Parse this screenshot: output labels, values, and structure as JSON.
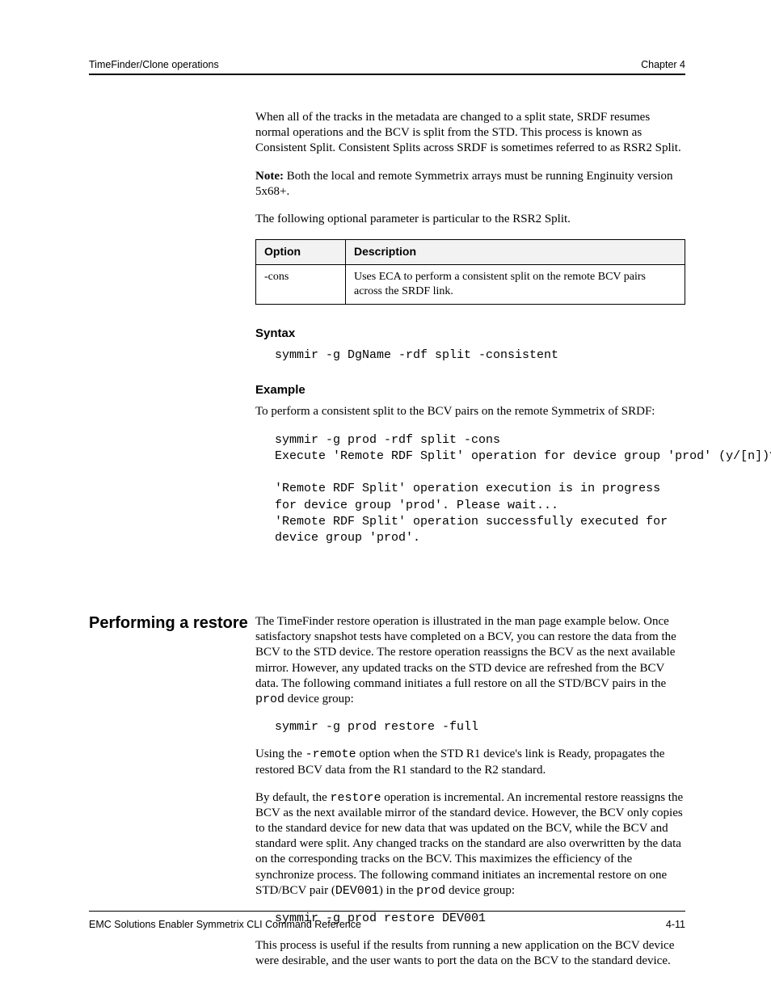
{
  "header": {
    "doc_title": "TimeFinder/Clone operations",
    "chapter_label": "Chapter 4"
  },
  "body": {
    "intro_para": "When all of the tracks in the metadata are changed to a split state, SRDF resumes normal operations and the BCV is split from the STD. This process is known as Consistent Split. Consistent Splits across SRDF is sometimes referred to as RSR2 Split.",
    "note_prefix": "Note:",
    "note_text": " Both the local and remote Symmetrix arrays must be running Enginuity version 5x68+.",
    "optional_para": "The following optional parameter is particular to the RSR2 Split.",
    "table": {
      "headers": [
        "Option",
        "Description"
      ],
      "rows": [
        {
          "option": "-cons",
          "description": "Uses ECA to perform a consistent split on the remote BCV pairs across the SRDF link."
        }
      ]
    },
    "syntax_label": "Syntax",
    "syntax_line": "symmir -g DgName -rdf split -consistent",
    "example_label": "Example",
    "example_intro": "To perform a consistent split to the BCV pairs on the remote Symmetrix of SRDF:",
    "example_code": "symmir -g prod -rdf split -cons\nExecute 'Remote RDF Split' operation for device group 'prod' (y/[n])?  y\n\n'Remote RDF Split' operation execution is in progress\nfor device group 'prod'. Please wait...\n'Remote RDF Split' operation successfully executed for\ndevice group 'prod'.",
    "section2": {
      "heading": "Performing a restore",
      "para1_pre": "The TimeFinder restore operation is illustrated in the man page example below. Once satisfactory snapshot tests have completed on a BCV, you can restore the data from the BCV to the STD device. The restore operation reassigns the BCV as the next available mirror. However, any updated tracks on the STD device are refreshed from the BCV data. The following command initiates a full restore on all the STD/BCV pairs in the ",
      "para1_code": "prod",
      "para1_post": " device group:",
      "cmd1": "symmir -g prod restore -full",
      "para2_pre": "Using the ",
      "para2_code": " -remote",
      "para2_post": " option when the STD R1 device's link is Ready, propagates the restored BCV data from the R1 standard to the R2 standard.",
      "para3_pre": "By default, the ",
      "para3_code1": "restore",
      "para3_mid": " operation is incremental. An incremental restore reassigns the BCV as the next available mirror of the standard device. However, the BCV only copies to the standard device for new data that was updated on the BCV, while the BCV and standard were split. Any changed tracks on the standard are also overwritten by the data on the corresponding tracks on the BCV. This maximizes the efficiency of the synchronize process. The following command initiates an incremental restore on one STD/BCV pair (",
      "para3_code2": "DEV001",
      "para3_mid2": ") in the ",
      "para3_code3": "prod",
      "para3_post": " device group:",
      "cmd2": "symmir -g prod restore DEV001",
      "para4": "This process is useful if the results from running a new application on the BCV device were desirable, and the user wants to port the data on the BCV to the standard device."
    }
  },
  "footer": {
    "left": "EMC Solutions Enabler Symmetrix CLI Command Reference",
    "page": "4-11"
  }
}
